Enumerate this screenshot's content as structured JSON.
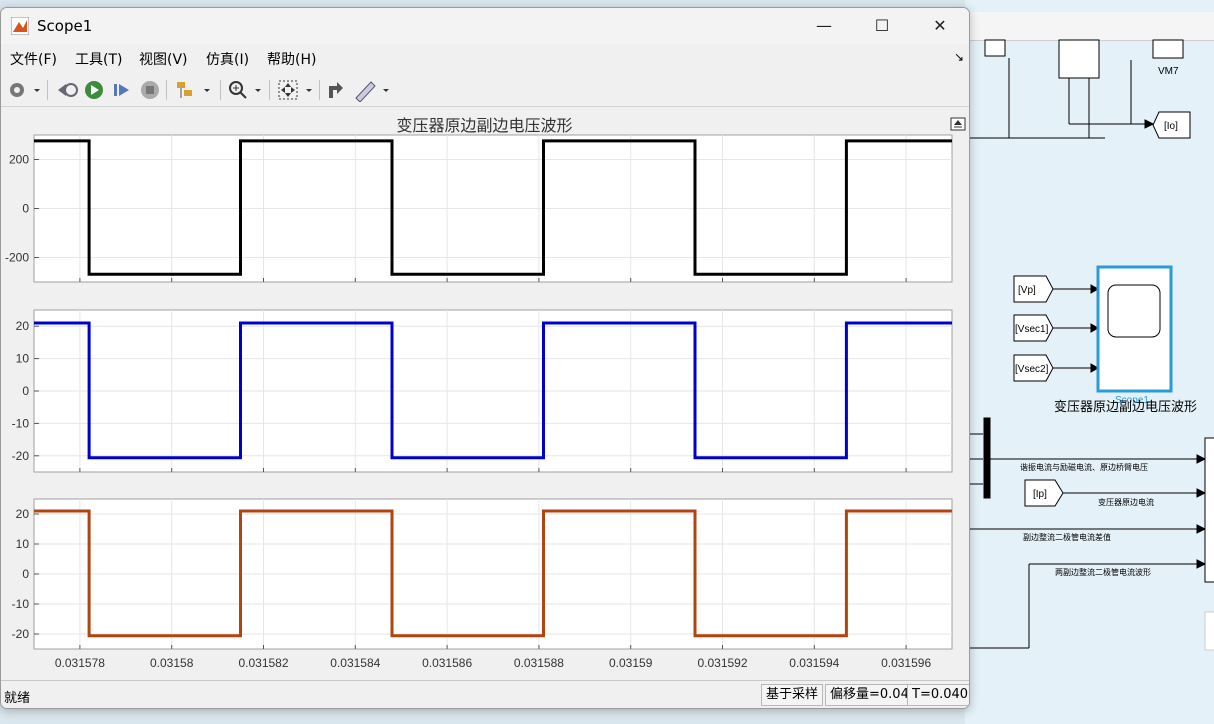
{
  "window": {
    "title": "Scope1"
  },
  "menu": [
    "文件(F)",
    "工具(T)",
    "视图(V)",
    "仿真(I)",
    "帮助(H)"
  ],
  "plot": {
    "title": "变压器原边副边电压波形"
  },
  "status": {
    "left": "就绪",
    "mode": "基于采样",
    "offset": "偏移量=0.04",
    "time": "T=0.040"
  },
  "simulink": {
    "labels": {
      "vm7": "VM7",
      "io": "[Io]",
      "vp": "[Vp]",
      "vsec1": "[Vsec1]",
      "vsec2": "[Vsec2]",
      "scope_name": "Scope1",
      "scope_caption": "变压器原边副边电压波形",
      "ip": "[Ip]",
      "sig1": "谐振电流与励磁电流、原边桥臂电压",
      "sig2": "变压器原边电流",
      "sig3": "副边整流二极管电流差值",
      "sig4": "两副边整流二极管电流波形"
    }
  },
  "chart_data": [
    {
      "type": "line",
      "title": "变压器原边副边电压波形",
      "xlim": [
        0.031577,
        0.031597
      ],
      "x_ticks": [
        "0.031578",
        "0.03158",
        "0.031582",
        "0.031584",
        "0.031586",
        "0.031588",
        "0.03159",
        "0.031592",
        "0.031594",
        "0.031596"
      ],
      "ylim": [
        -300,
        300
      ],
      "y_ticks": [
        "200",
        "0",
        "-200"
      ],
      "y_tick_values": [
        200,
        0,
        -200
      ],
      "grid": true,
      "series": [
        {
          "color": "#000000",
          "x": [
            0.031577,
            0.0315782,
            0.0315782,
            0.0315815,
            0.0315815,
            0.0315848,
            0.0315848,
            0.0315881,
            0.0315881,
            0.0315914,
            0.0315914,
            0.0315947,
            0.0315947,
            0.031597
          ],
          "y": [
            276,
            276,
            -268,
            -268,
            276,
            276,
            -268,
            -268,
            276,
            276,
            -268,
            -268,
            276,
            276
          ]
        }
      ]
    },
    {
      "type": "line",
      "xlim": [
        0.031577,
        0.031597
      ],
      "ylim": [
        -25,
        25
      ],
      "y_ticks": [
        "20",
        "10",
        "0",
        "-10",
        "-20"
      ],
      "y_tick_values": [
        20,
        10,
        0,
        -10,
        -20
      ],
      "grid": true,
      "series": [
        {
          "color": "#0000cc",
          "x": [
            0.031577,
            0.0315782,
            0.0315782,
            0.0315815,
            0.0315815,
            0.0315848,
            0.0315848,
            0.0315881,
            0.0315881,
            0.0315914,
            0.0315914,
            0.0315947,
            0.0315947,
            0.031597
          ],
          "y": [
            21,
            21,
            -20.6,
            -20.6,
            21,
            21,
            -20.6,
            -20.6,
            21,
            21,
            -20.6,
            -20.6,
            21,
            21
          ]
        }
      ]
    },
    {
      "type": "line",
      "xlim": [
        0.031577,
        0.031597
      ],
      "ylim": [
        -25,
        25
      ],
      "y_ticks": [
        "20",
        "10",
        "0",
        "-10",
        "-20"
      ],
      "y_tick_values": [
        20,
        10,
        0,
        -10,
        -20
      ],
      "grid": true,
      "series": [
        {
          "color": "#b04510",
          "x": [
            0.031577,
            0.0315782,
            0.0315782,
            0.0315815,
            0.0315815,
            0.0315848,
            0.0315848,
            0.0315881,
            0.0315881,
            0.0315914,
            0.0315914,
            0.0315947,
            0.0315947,
            0.031597
          ],
          "y": [
            21,
            21,
            -20.6,
            -20.6,
            21,
            21,
            -20.6,
            -20.6,
            21,
            21,
            -20.6,
            -20.6,
            21,
            21
          ]
        }
      ]
    }
  ]
}
